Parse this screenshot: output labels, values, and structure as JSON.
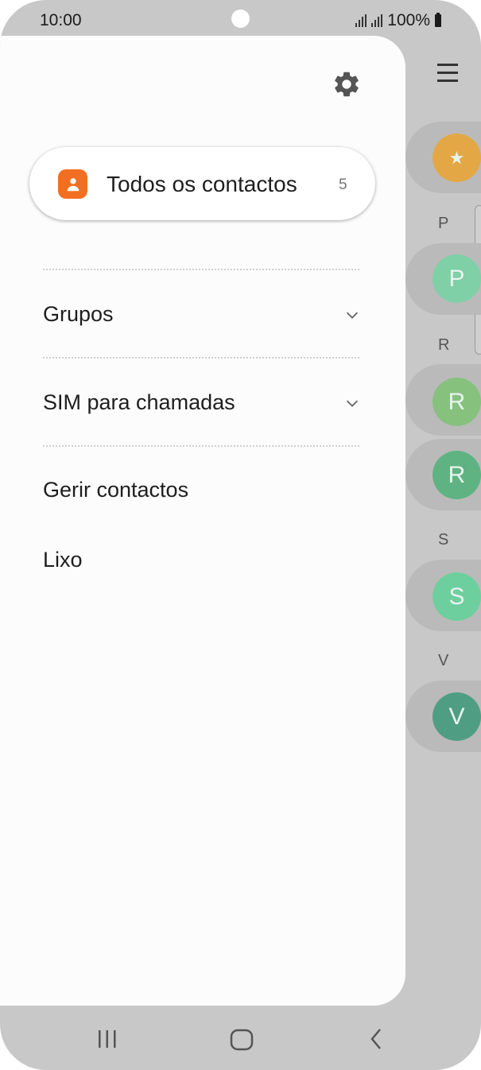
{
  "status": {
    "time": "10:00",
    "battery": "100%"
  },
  "drawer": {
    "settings_icon": "gear-icon",
    "all_contacts": {
      "label": "Todos os contactos",
      "count": "5",
      "icon": "person-icon"
    },
    "items": [
      {
        "label": "Grupos",
        "expandable": true
      },
      {
        "label": "SIM para chamadas",
        "expandable": true
      },
      {
        "label": "Gerir contactos",
        "expandable": false
      },
      {
        "label": "Lixo",
        "expandable": false
      }
    ]
  },
  "background_list": {
    "sections": [
      "P",
      "R",
      "S",
      "V"
    ],
    "avatars": [
      "★",
      "P",
      "R",
      "R",
      "S",
      "V"
    ],
    "avatar_colors": [
      "#e3a845",
      "#7fd0a6",
      "#86c17e",
      "#5fb382",
      "#6ecf9e",
      "#4f9e84"
    ]
  },
  "navbar": {
    "recents_icon": "recents-icon",
    "home_icon": "home-icon",
    "back_icon": "back-icon"
  },
  "colors": {
    "accent": "#f26f21",
    "drawer_bg": "#fcfcfc",
    "scrim": "#c8c8c8"
  }
}
